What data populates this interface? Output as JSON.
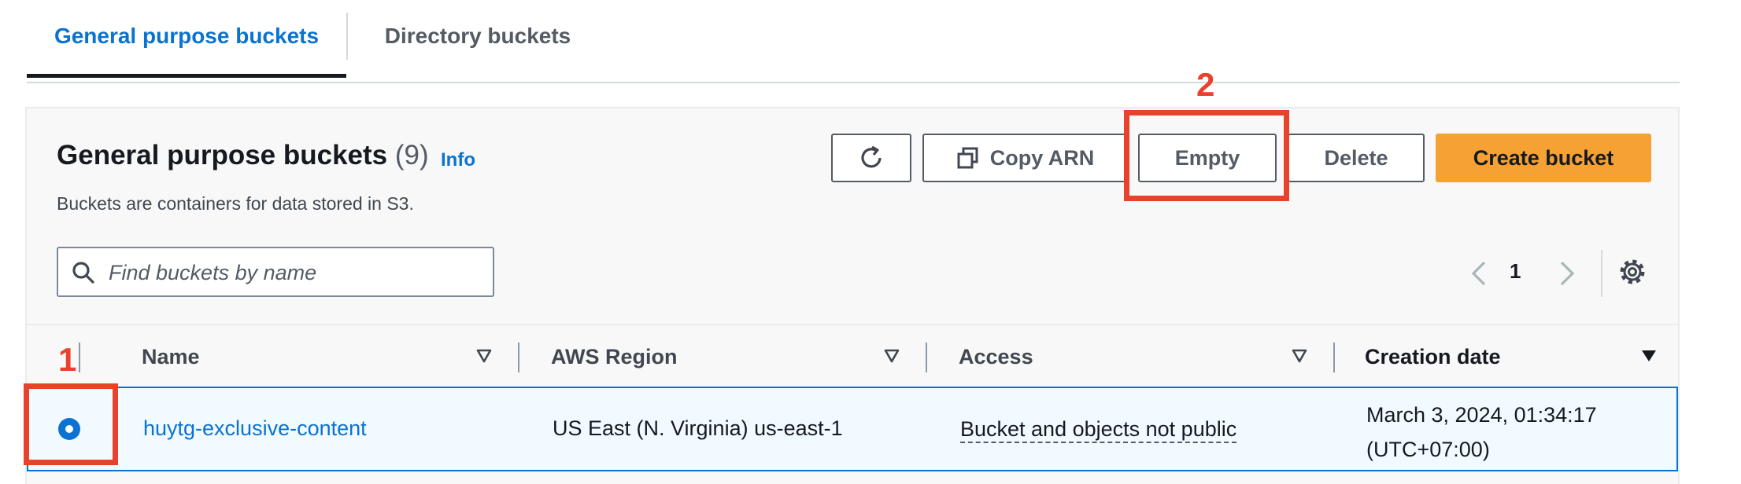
{
  "tabs": {
    "general": "General purpose buckets",
    "directory": "Directory buckets"
  },
  "panel": {
    "title": "General purpose buckets",
    "count": "(9)",
    "info": "Info",
    "description": "Buckets are containers for data stored in S3."
  },
  "toolbar": {
    "refresh_icon": "refresh-icon",
    "copy_arn": "Copy ARN",
    "copy_icon": "copy-icon",
    "empty": "Empty",
    "delete": "Delete",
    "create": "Create bucket"
  },
  "search": {
    "placeholder": "Find buckets by name",
    "value": ""
  },
  "pagination": {
    "page": "1"
  },
  "table": {
    "columns": [
      "Name",
      "AWS Region",
      "Access",
      "Creation date"
    ],
    "rows": [
      {
        "selected": true,
        "name": "huytg-exclusive-content",
        "region": "US East (N. Virginia) us-east-1",
        "access": "Bucket and objects not public",
        "created_line1": "March 3, 2024, 01:34:17",
        "created_line2": "(UTC+07:00)"
      }
    ]
  },
  "annotations": [
    "1",
    "2"
  ],
  "colors": {
    "accent": "#0972d3",
    "create_button": "#f5a133",
    "annotation": "#e8412c"
  }
}
